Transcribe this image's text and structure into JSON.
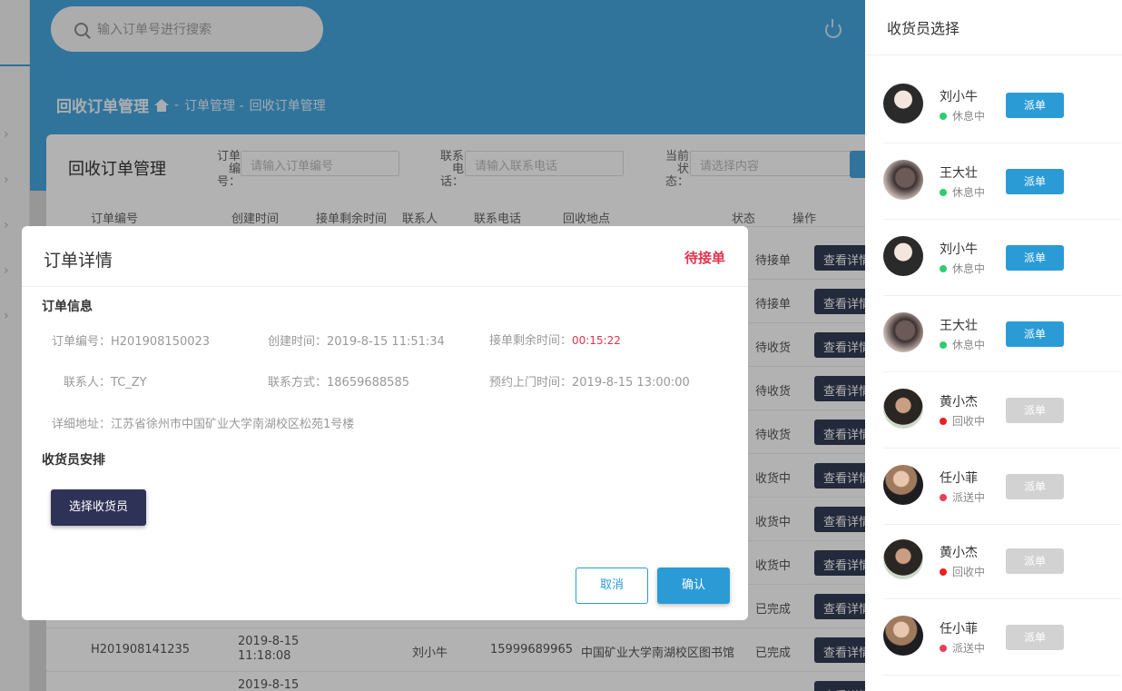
{
  "search": {
    "placeholder": "输入订单号进行搜索"
  },
  "breadcrumb": {
    "current": "回收订单管理",
    "sep1": "-",
    "level1": "订单管理 -",
    "level2": "回收订单管理"
  },
  "card": {
    "title": "回收订单管理",
    "filters": {
      "order_no_label": "订单编号：",
      "order_no_placeholder": "请输入订单编号",
      "phone_label": "联系电话：",
      "phone_placeholder": "请输入联系电话",
      "status_label": "当前状态：",
      "status_placeholder": "请选择内容"
    },
    "columns": [
      "订单编号",
      "创建时间",
      "接单剩余时间",
      "联系人",
      "联系电话",
      "回收地点",
      "状态",
      "操作"
    ],
    "rows": [
      {
        "status": "待接单",
        "action": "查看详情"
      },
      {
        "status": "待接单",
        "action": "查看详情"
      },
      {
        "status": "待收货",
        "action": "查看详情"
      },
      {
        "status": "待收货",
        "action": "查看详情"
      },
      {
        "status": "待收货",
        "action": "查看详情"
      },
      {
        "status": "收货中",
        "action": "查看详情"
      },
      {
        "status": "收货中",
        "action": "查看详情"
      },
      {
        "status": "收货中",
        "action": "查看详情"
      },
      {
        "status": "已完成",
        "action": "查看详情"
      },
      {
        "order_no": "H201908141235",
        "created_date": "2019-8-15",
        "created_time": "11:18:08",
        "contact": "刘小牛",
        "phone": "15999689965",
        "place": "中国矿业大学南湖校区图书馆",
        "status": "已完成",
        "action": "查看详情"
      },
      {
        "created_date": "2019-8-15",
        "status": "",
        "action": "查看详情"
      }
    ]
  },
  "modal": {
    "title": "订单详情",
    "status": "待接单",
    "order_section": "订单信息",
    "order_no_label": "订单编号：",
    "order_no": "H201908150023",
    "created_label": "创建时间：",
    "created": "2019-8-15 11:51:34",
    "remaining_label": "接单剩余时间：",
    "remaining": "00:15:22",
    "contact_label": "联系人：",
    "contact": "TC_ZY",
    "phone_label": "联系方式：",
    "phone": "18659688585",
    "visit_label": "预约上门时间：",
    "visit": "2019-8-15 13:00:00",
    "address_label": "详细地址：",
    "address": "江苏省徐州市中国矿业大学南湖校区松苑1号楼",
    "collector_section": "收货员安排",
    "pick_button": "选择收货员",
    "cancel": "取消",
    "confirm": "确认"
  },
  "panel": {
    "title": "收货员选择",
    "people": [
      {
        "name": "刘小牛",
        "status": "休息中",
        "status_color": "#2ecc71",
        "action": "派单",
        "enabled": true
      },
      {
        "name": "王大壮",
        "status": "休息中",
        "status_color": "#2ecc71",
        "action": "派单",
        "enabled": true
      },
      {
        "name": "刘小牛",
        "status": "休息中",
        "status_color": "#2ecc71",
        "action": "派单",
        "enabled": true
      },
      {
        "name": "王大壮",
        "status": "休息中",
        "status_color": "#2ecc71",
        "action": "派单",
        "enabled": true
      },
      {
        "name": "黄小杰",
        "status": "回收中",
        "status_color": "#e82222",
        "action": "派单",
        "enabled": false
      },
      {
        "name": "任小菲",
        "status": "派送中",
        "status_color": "#e8405a",
        "action": "派单",
        "enabled": false
      },
      {
        "name": "黄小杰",
        "status": "回收中",
        "status_color": "#e82222",
        "action": "派单",
        "enabled": false
      },
      {
        "name": "任小菲",
        "status": "派送中",
        "status_color": "#e8405a",
        "action": "派单",
        "enabled": false
      }
    ]
  },
  "colors": {
    "accent": "#2b9bd6",
    "header": "#45a6e0",
    "danger": "#e0344e",
    "dark_button": "#2f3257"
  }
}
